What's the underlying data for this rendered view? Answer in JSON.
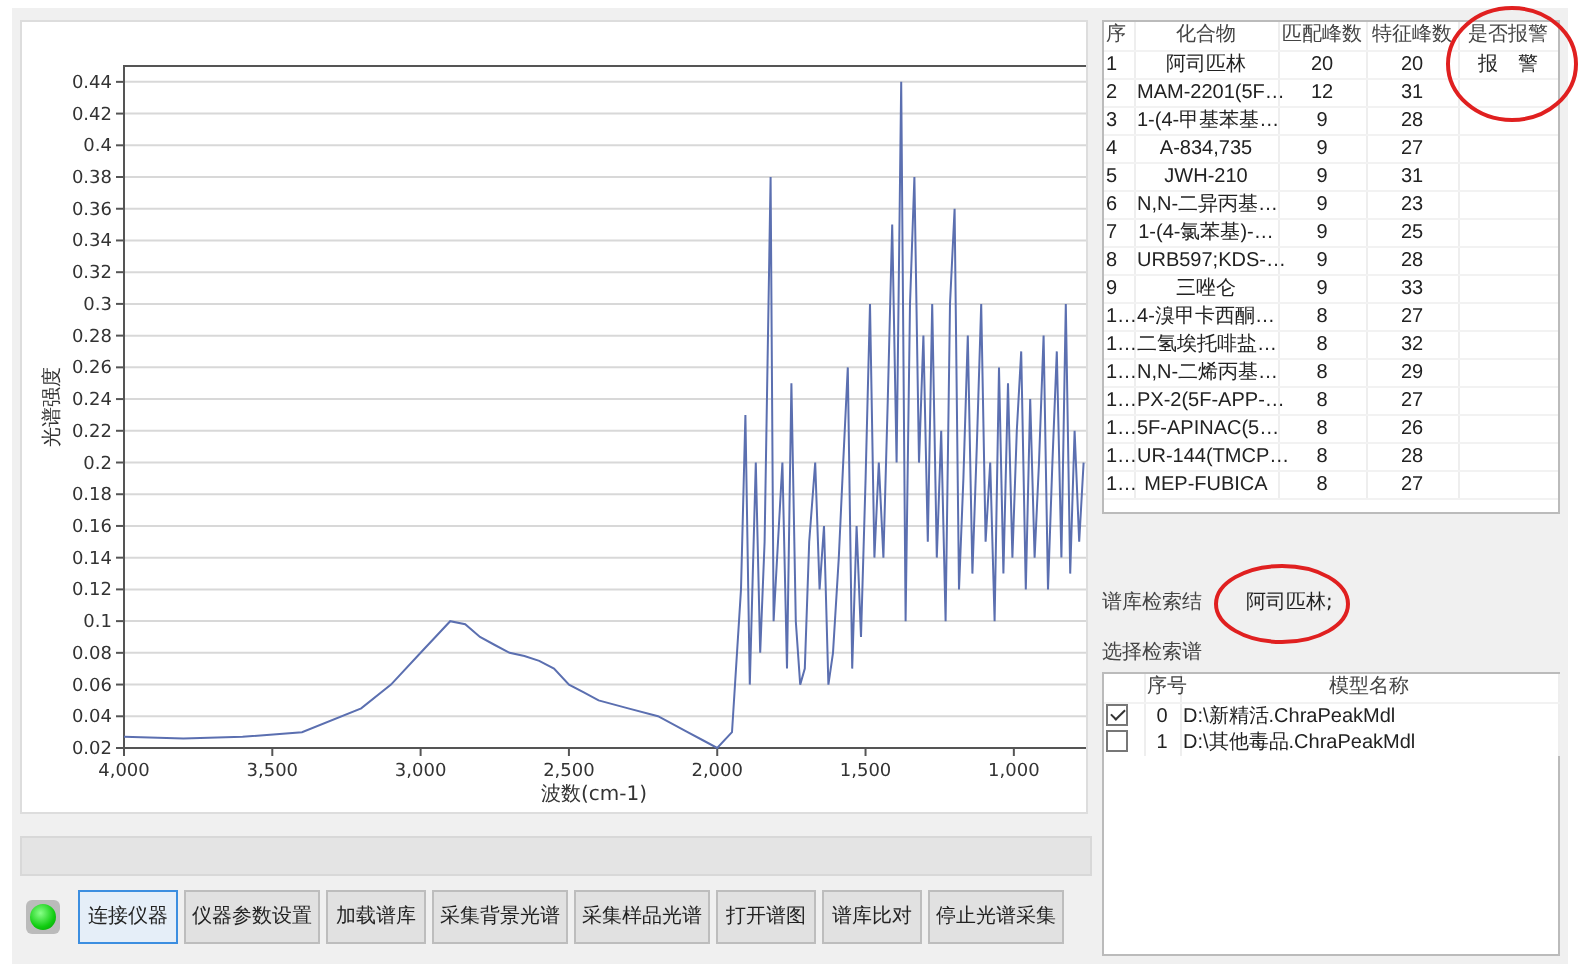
{
  "chart": {
    "chart_data": {
      "type": "line",
      "xlabel": "波数(cm-1)",
      "ylabel": "光谱强度",
      "xlim": [
        4000,
        750
      ],
      "ylim": [
        0.02,
        0.45
      ],
      "grid": true,
      "xticks": [
        {
          "value": 4000,
          "label": "4,000"
        },
        {
          "value": 3500,
          "label": "3,500"
        },
        {
          "value": 3000,
          "label": "3,000"
        },
        {
          "value": 2500,
          "label": "2,500"
        },
        {
          "value": 2000,
          "label": "2,000"
        },
        {
          "value": 1500,
          "label": "1,500"
        },
        {
          "value": 1000,
          "label": "1,000"
        }
      ],
      "yticks": [
        0.02,
        0.04,
        0.06,
        0.08,
        0.1,
        0.12,
        0.14,
        0.16,
        0.18,
        0.2,
        0.22,
        0.24,
        0.26,
        0.28,
        0.3,
        0.32,
        0.34,
        0.36,
        0.38,
        0.4,
        0.42,
        0.44
      ],
      "x": [
        4000,
        3800,
        3600,
        3400,
        3200,
        3100,
        3000,
        2950,
        2900,
        2850,
        2800,
        2750,
        2700,
        2650,
        2600,
        2550,
        2500,
        2450,
        2400,
        2300,
        2200,
        2100,
        2050,
        2000,
        1950,
        1920,
        1905,
        1890,
        1870,
        1855,
        1840,
        1820,
        1810,
        1795,
        1780,
        1765,
        1750,
        1735,
        1720,
        1705,
        1690,
        1670,
        1655,
        1640,
        1625,
        1610,
        1590,
        1575,
        1560,
        1545,
        1530,
        1515,
        1500,
        1485,
        1470,
        1455,
        1440,
        1425,
        1410,
        1395,
        1380,
        1365,
        1350,
        1335,
        1320,
        1305,
        1290,
        1275,
        1260,
        1245,
        1230,
        1215,
        1200,
        1185,
        1170,
        1155,
        1140,
        1125,
        1110,
        1095,
        1080,
        1065,
        1050,
        1035,
        1020,
        1005,
        990,
        975,
        960,
        945,
        930,
        915,
        900,
        885,
        870,
        855,
        840,
        825,
        810,
        795,
        780,
        765
      ],
      "series": [
        {
          "color": "#5b6fb0",
          "values": [
            0.027,
            0.026,
            0.027,
            0.03,
            0.045,
            0.06,
            0.08,
            0.09,
            0.1,
            0.098,
            0.09,
            0.085,
            0.08,
            0.078,
            0.075,
            0.07,
            0.06,
            0.055,
            0.05,
            0.045,
            0.04,
            0.03,
            0.025,
            0.02,
            0.03,
            0.12,
            0.23,
            0.06,
            0.2,
            0.08,
            0.15,
            0.38,
            0.1,
            0.15,
            0.2,
            0.07,
            0.25,
            0.1,
            0.06,
            0.07,
            0.15,
            0.2,
            0.12,
            0.16,
            0.06,
            0.08,
            0.14,
            0.2,
            0.26,
            0.07,
            0.16,
            0.09,
            0.19,
            0.3,
            0.14,
            0.2,
            0.14,
            0.24,
            0.35,
            0.2,
            0.44,
            0.1,
            0.3,
            0.38,
            0.2,
            0.28,
            0.15,
            0.3,
            0.14,
            0.22,
            0.1,
            0.3,
            0.36,
            0.12,
            0.19,
            0.28,
            0.13,
            0.21,
            0.3,
            0.15,
            0.2,
            0.1,
            0.26,
            0.13,
            0.25,
            0.14,
            0.22,
            0.27,
            0.12,
            0.24,
            0.14,
            0.2,
            0.28,
            0.12,
            0.2,
            0.27,
            0.14,
            0.3,
            0.13,
            0.22,
            0.15,
            0.2
          ]
        }
      ]
    }
  },
  "status_led": {
    "on": true
  },
  "buttons": [
    {
      "label": "连接仪器",
      "selected": true
    },
    {
      "label": "仪器参数设置",
      "selected": false
    },
    {
      "label": "加载谱库",
      "selected": false
    },
    {
      "label": "采集背景光谱",
      "selected": false
    },
    {
      "label": "采集样品光谱",
      "selected": false
    },
    {
      "label": "打开谱图",
      "selected": false
    },
    {
      "label": "谱库比对",
      "selected": false
    },
    {
      "label": "停止光谱采集",
      "selected": false
    }
  ],
  "results_table": {
    "columns": [
      "序",
      "化合物",
      "匹配峰数",
      "特征峰数",
      "是否报警"
    ],
    "rows": [
      [
        "1",
        "阿司匹林",
        "20",
        "20",
        "报　警"
      ],
      [
        "2",
        "MAM-2201(5F…",
        "12",
        "31",
        ""
      ],
      [
        "3",
        "1-(4-甲基苯基…",
        "9",
        "28",
        ""
      ],
      [
        "4",
        "A-834,735",
        "9",
        "27",
        ""
      ],
      [
        "5",
        "JWH-210",
        "9",
        "31",
        ""
      ],
      [
        "6",
        "N,N-二异丙基…",
        "9",
        "23",
        ""
      ],
      [
        "7",
        "1-(4-氯苯基)-…",
        "9",
        "25",
        ""
      ],
      [
        "8",
        "URB597;KDS-…",
        "9",
        "28",
        ""
      ],
      [
        "9",
        "三唑仑",
        "9",
        "33",
        ""
      ],
      [
        "1…",
        "4-溴甲卡西酮…",
        "8",
        "27",
        ""
      ],
      [
        "1…",
        "二氢埃托啡盐…",
        "8",
        "32",
        ""
      ],
      [
        "1…",
        "N,N-二烯丙基…",
        "8",
        "29",
        ""
      ],
      [
        "1…",
        "PX-2(5F-APP-…",
        "8",
        "27",
        ""
      ],
      [
        "1…",
        "5F-APINAC(5…",
        "8",
        "26",
        ""
      ],
      [
        "1…",
        "UR-144(TMCP…",
        "8",
        "28",
        ""
      ],
      [
        "1…",
        "MEP-FUBICA",
        "8",
        "27",
        ""
      ]
    ]
  },
  "search_result": {
    "label": "谱库检索结",
    "value": "阿司匹林;"
  },
  "library_select": {
    "label": "选择检索谱",
    "columns": [
      "序号",
      "模型名称"
    ],
    "rows": [
      {
        "checked": true,
        "index": "0",
        "name": "D:\\新精活.ChraPeakMdl"
      },
      {
        "checked": false,
        "index": "1",
        "name": "D:\\其他毒品.ChraPeakMdl"
      }
    ]
  }
}
